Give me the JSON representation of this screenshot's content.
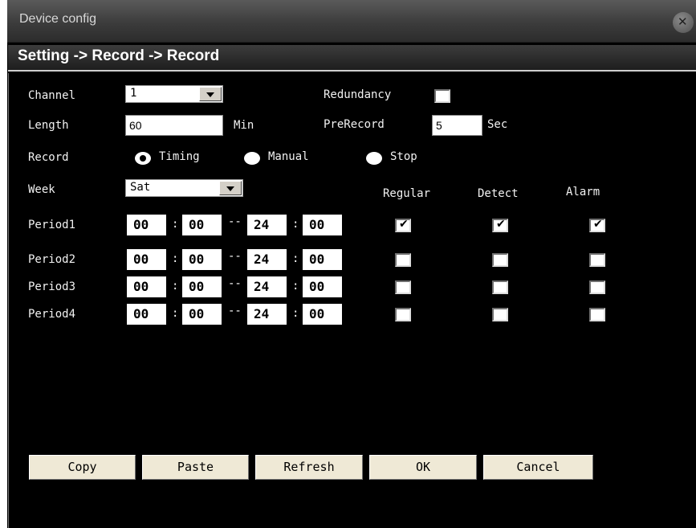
{
  "window": {
    "title": "Device config"
  },
  "breadcrumb": "Setting -> Record -> Record",
  "channel": {
    "label": "Channel",
    "value": "1"
  },
  "redundancy": {
    "label": "Redundancy",
    "checked": false
  },
  "length": {
    "label": "Length",
    "value": "60",
    "unit": "Min"
  },
  "prerecord": {
    "label": "PreRecord",
    "value": "5",
    "unit": "Sec"
  },
  "record": {
    "label": "Record",
    "options": [
      "Timing",
      "Manual",
      "Stop"
    ],
    "selected": "Timing"
  },
  "week": {
    "label": "Week",
    "value": "Sat"
  },
  "columns": [
    "Regular",
    "Detect",
    "Alarm"
  ],
  "periods": [
    {
      "label": "Period1",
      "start_h": "00",
      "start_m": "00",
      "end_h": "24",
      "end_m": "00",
      "regular": true,
      "detect": true,
      "alarm": true
    },
    {
      "label": "Period2",
      "start_h": "00",
      "start_m": "00",
      "end_h": "24",
      "end_m": "00",
      "regular": false,
      "detect": false,
      "alarm": false
    },
    {
      "label": "Period3",
      "start_h": "00",
      "start_m": "00",
      "end_h": "24",
      "end_m": "00",
      "regular": false,
      "detect": false,
      "alarm": false
    },
    {
      "label": "Period4",
      "start_h": "00",
      "start_m": "00",
      "end_h": "24",
      "end_m": "00",
      "regular": false,
      "detect": false,
      "alarm": false
    }
  ],
  "time_separators": {
    "colon": ":",
    "range": "--"
  },
  "buttons": {
    "copy": "Copy",
    "paste": "Paste",
    "refresh": "Refresh",
    "ok": "OK",
    "cancel": "Cancel"
  }
}
